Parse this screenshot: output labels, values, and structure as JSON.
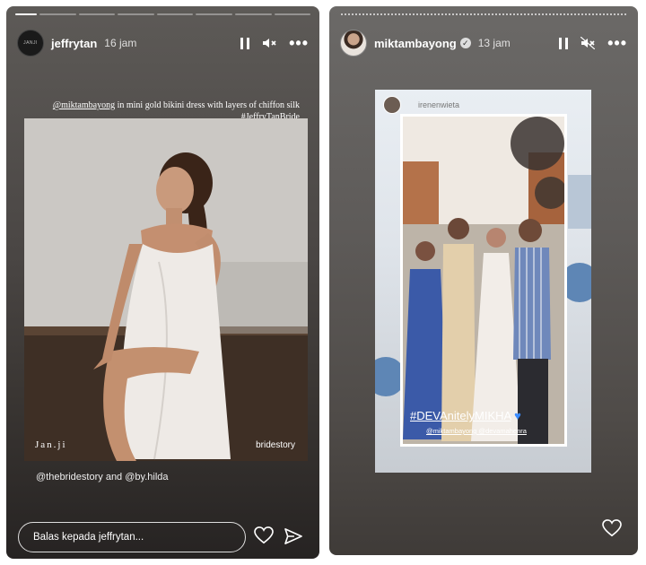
{
  "left_story": {
    "username": "jeffrytan",
    "time": "16 jam",
    "avatar_text": "JANJI",
    "caption_mention": "@miktambayong",
    "caption_text": " in mini gold bikini dress with layers of chiffon silk",
    "caption_hashtag": "#JeffryTanBride",
    "watermark_left": "Jan.ji",
    "watermark_right": "bridestory",
    "mention_1": "@thebridestory",
    "mention_and": " and ",
    "mention_2": "@by.hilda",
    "reply_placeholder": "Balas kepada jeffrytan..."
  },
  "right_story": {
    "username": "miktambayong",
    "time": "13 jam",
    "repost_user": "irenenwieta",
    "hashtag": "#DEVAnitelyMIKHA",
    "tags": "@miktambayong @devamahenra"
  },
  "icons": [
    "pause-icon",
    "mute-icon",
    "more-icon",
    "heart-icon",
    "send-icon"
  ],
  "colors": {
    "heart_emoji": "#3b8cff"
  }
}
